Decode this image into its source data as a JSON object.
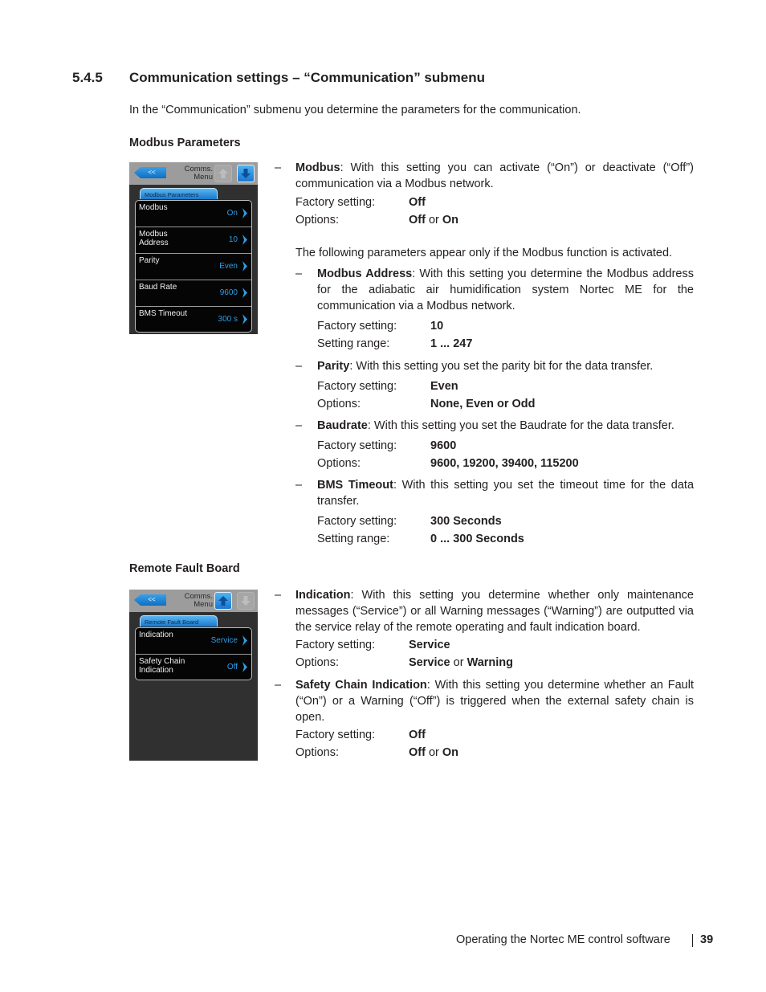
{
  "section": {
    "number": "5.4.5",
    "title": "Communication settings – “Communication” submenu",
    "intro": "In the “Communication” submenu you determine the parameters for the communication."
  },
  "modbus": {
    "heading": "Modbus Parameters",
    "screen": {
      "back_label": "<<",
      "title_line1": "Comms.",
      "title_line2": "Menu",
      "up_state": "inactive",
      "down_state": "active",
      "tab_label": "Modbus Parameters",
      "rows": [
        {
          "label1": "Modbus",
          "label2": "",
          "value": "On"
        },
        {
          "label1": "Modbus",
          "label2": "Address",
          "value": "10"
        },
        {
          "label1": "Parity",
          "label2": "",
          "value": "Even"
        },
        {
          "label1": "Baud Rate",
          "label2": "",
          "value": "9600"
        },
        {
          "label1": "BMS Timeout",
          "label2": "",
          "value": "300 s"
        }
      ]
    },
    "items": {
      "modbus": {
        "name": "Modbus",
        "text": ": With this setting you can activate (“On”) or deactivate (“Off”) communication via a Modbus network.",
        "factory_label": "Factory setting:",
        "factory_value": "Off",
        "options_label": "Options:",
        "options_a": "Off",
        "options_or": " or ",
        "options_b": "On"
      },
      "note": "The following parameters appear only if the Modbus function is activated.",
      "address": {
        "name": "Modbus Address",
        "text": ": With this setting you determine the Modbus ad­dress for the adiabatic air humidification system Nortec ME for the communication via a Modbus network.",
        "factory_label": "Factory setting:",
        "factory_value": "10",
        "range_label": "Setting range:",
        "range_value": "1 ... 247"
      },
      "parity": {
        "name": "Parity",
        "text": ": With this setting you set the parity bit for the data transfer.",
        "factory_label": "Factory setting:",
        "factory_value": "Even",
        "options_label": "Options:",
        "options_value": "None, Even or Odd"
      },
      "baudrate": {
        "name": "Baudrate",
        "text": ": With this setting you set the Baudrate for the data transfer.",
        "factory_label": "Factory setting:",
        "factory_value": "9600",
        "options_label": "Options:",
        "options_value": "9600, 19200, 39400, 115200"
      },
      "timeout": {
        "name": "BMS Timeout",
        "text": ": With this setting you set the timeout time for the data transfer.",
        "factory_label": "Factory setting:",
        "factory_value": "300 Seconds",
        "range_label": "Setting range:",
        "range_value": "0 ... 300 Seconds"
      }
    }
  },
  "remote": {
    "heading": "Remote Fault Board",
    "screen": {
      "back_label": "<<",
      "title_line1": "Comms.",
      "title_line2": "Menu",
      "up_state": "active",
      "down_state": "inactive",
      "tab_label": "Remote Fault Board",
      "rows": [
        {
          "label1": "Indication",
          "label2": "",
          "value": "Service"
        },
        {
          "label1": "Safety Chain",
          "label2": "Indication",
          "value": "Off"
        }
      ]
    },
    "items": {
      "indication": {
        "name": "Indication",
        "text": ": With this setting you determine whether only maintenance messages  (“Service”) or all Warning messages (“Warning”) are outputted via the service relay of the remote operating and fault indication board.",
        "factory_label": "Factory setting:",
        "factory_value": "Service",
        "options_label": "Options:",
        "options_a": "Service",
        "options_or": " or ",
        "options_b": "Warning"
      },
      "safety": {
        "name": "Safety Chain Indication",
        "text": ": With this setting you determine whether an Fault (“On”) or a Warning (“Off”) is triggered when the external safety chain is open.",
        "factory_label": "Factory setting:",
        "factory_value": "Off",
        "options_label": "Options:",
        "options_a": "Off",
        "options_or": " or ",
        "options_b": "On"
      }
    }
  },
  "footer": {
    "text": "Operating the Nortec ME control software",
    "page": "39"
  },
  "colors": {
    "accent_blue": "#2e9ee6",
    "screen_bg": "#303030",
    "header_gray": "#9c9c9c"
  }
}
